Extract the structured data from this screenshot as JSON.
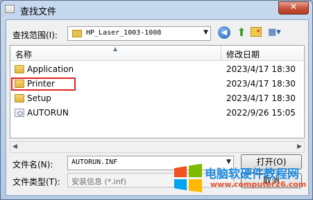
{
  "window": {
    "title": "查找文件",
    "close_glyph": "✕"
  },
  "lookin": {
    "label": "查找范围(I):",
    "value": "HP_Laser_1003-1008"
  },
  "toolbar": {
    "back_icon": "back-arrow-icon",
    "up_icon": "up-folder-icon",
    "new_folder_icon": "new-folder-icon",
    "view_menu_icon": "view-menu-icon"
  },
  "list": {
    "columns": {
      "name": "名称",
      "date": "修改日期"
    },
    "rows": [
      {
        "name": "Application",
        "date": "2023/4/17 18:30",
        "type": "folder"
      },
      {
        "name": "Printer",
        "date": "2023/4/17 18:30",
        "type": "folder",
        "highlighted": true
      },
      {
        "name": "Setup",
        "date": "2023/4/17 18:30",
        "type": "folder"
      },
      {
        "name": "AUTORUN",
        "date": "2022/9/26 15:05",
        "type": "file"
      }
    ]
  },
  "filename": {
    "label": "文件名(N):",
    "value": "AUTORUN.INF"
  },
  "filetype": {
    "label": "文件类型(T):",
    "value": "安装信息 (*.inf)"
  },
  "buttons": {
    "open": "打开(O)",
    "cancel": "取消"
  },
  "watermark": {
    "title": "电脑软硬件教程网",
    "url": "www.computer26.com"
  },
  "colors": {
    "highlight_border": "#e02020",
    "watermark_blue": "#1e8be0",
    "watermark_orange": "#e2522f"
  }
}
